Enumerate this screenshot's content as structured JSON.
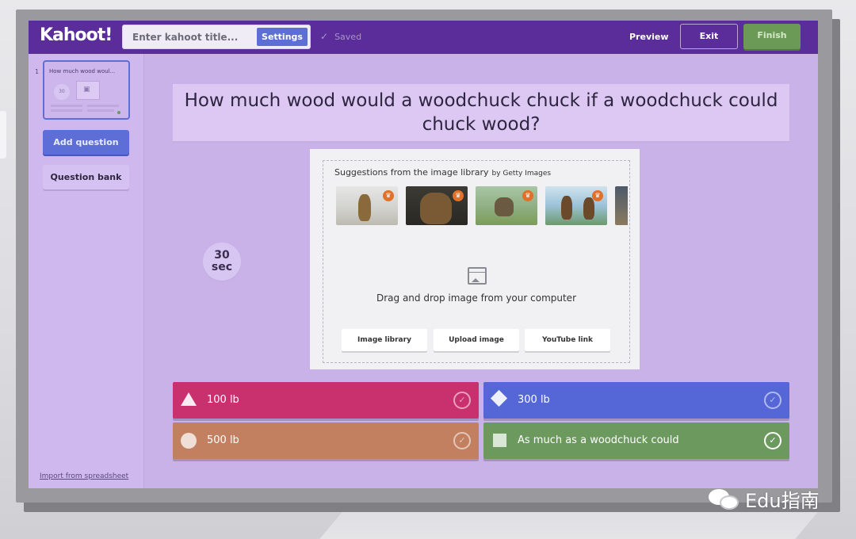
{
  "app": {
    "logo": "Kahoot!"
  },
  "topbar": {
    "title_placeholder": "Enter kahoot title...",
    "settings_label": "Settings",
    "saved_label": "Saved",
    "preview_label": "Preview",
    "exit_label": "Exit",
    "finish_label": "Finish"
  },
  "sidebar": {
    "slides": [
      {
        "number": "1",
        "title": "How much wood woul...",
        "time": "30"
      }
    ],
    "add_question_label": "Add question",
    "question_bank_label": "Question bank",
    "import_label": "Import from spreadsheet"
  },
  "question": {
    "text": "How much wood would a woodchuck chuck if a woodchuck could chuck wood?"
  },
  "timer": {
    "value": "30",
    "unit": "sec"
  },
  "media": {
    "suggestions_label": "Suggestions from the image library",
    "provider_label": "by Getty Images",
    "drop_text": "Drag and drop image from your computer",
    "buttons": {
      "image_library": "Image library",
      "upload_image": "Upload image",
      "youtube_link": "YouTube link"
    }
  },
  "answers": [
    {
      "text": "100 lb",
      "shape": "triangle",
      "color": "#c8306e",
      "correct": false
    },
    {
      "text": "300 lb",
      "shape": "diamond",
      "color": "#5566d6",
      "correct": false
    },
    {
      "text": "500 lb",
      "shape": "circle",
      "color": "#c28060",
      "correct": false
    },
    {
      "text": "As much as a woodchuck could",
      "shape": "square",
      "color": "#6c9a5e",
      "correct": true
    }
  ],
  "colors": {
    "brand_purple": "#5b2d9a",
    "accent_blue": "#5d6ed6",
    "finish_green": "#6a9a55"
  },
  "watermark": {
    "text": "Edu指南"
  }
}
